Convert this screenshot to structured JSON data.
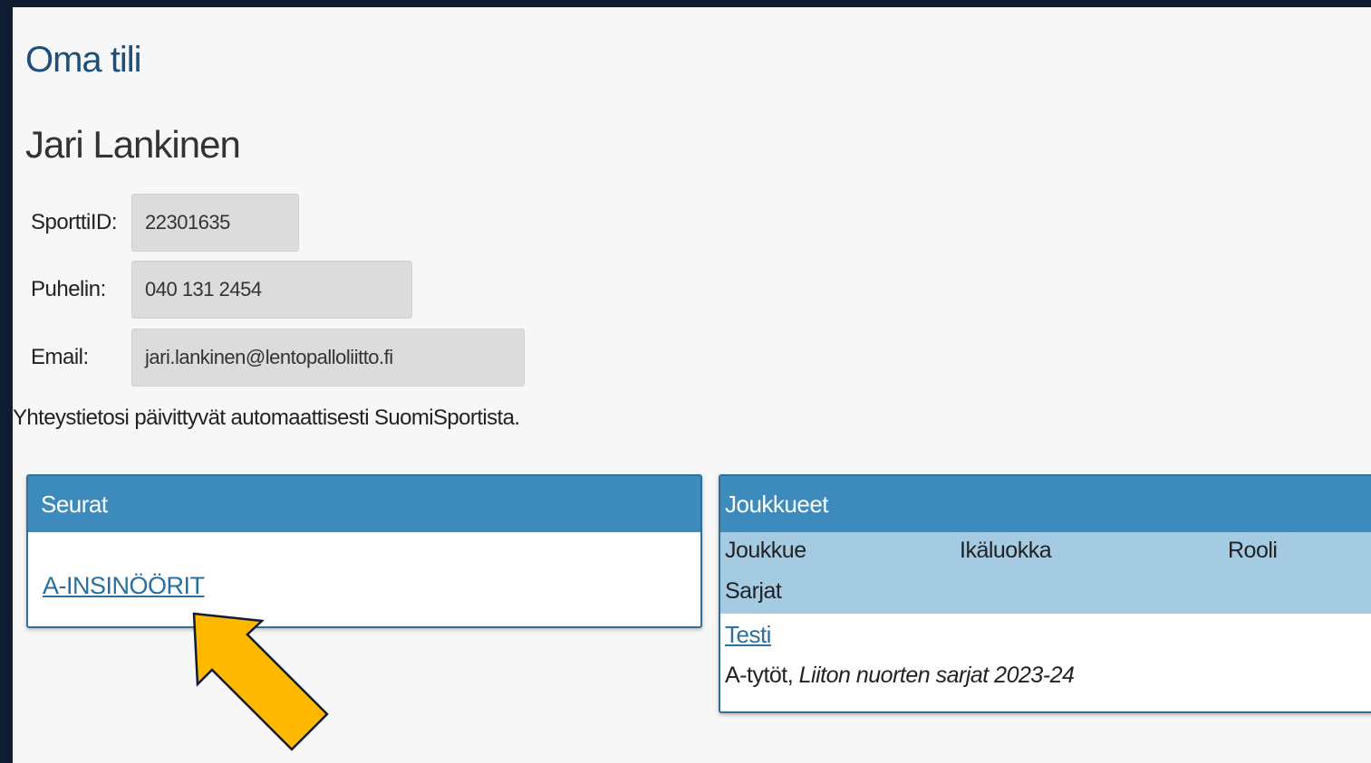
{
  "page": {
    "title": "Oma tili",
    "user_name": "Jari Lankinen"
  },
  "profile": {
    "fields": [
      {
        "label": "SporttiID:",
        "value": "22301635"
      },
      {
        "label": "Puhelin:",
        "value": "040 131 2454"
      },
      {
        "label": "Email:",
        "value": "jari.lankinen@lentopalloliitto.fi"
      }
    ],
    "info_text": "Yhteystietosi päivittyvät automaattisesti SuomiSportista."
  },
  "clubs": {
    "header": "Seurat",
    "items": [
      {
        "label": "A-INSINÖÖRIT"
      }
    ]
  },
  "teams": {
    "header": "Joukkueet",
    "columns": [
      "Joukkue",
      "Ikäluokka",
      "Rooli",
      "Sarjat"
    ],
    "rows": [
      {
        "team": "Testi",
        "age_class": "A-tytöt",
        "separator": ",",
        "series": "Liiton nuorten sarjat 2023-24"
      }
    ]
  },
  "annotation": {
    "arrow_color": "#ffb800"
  }
}
